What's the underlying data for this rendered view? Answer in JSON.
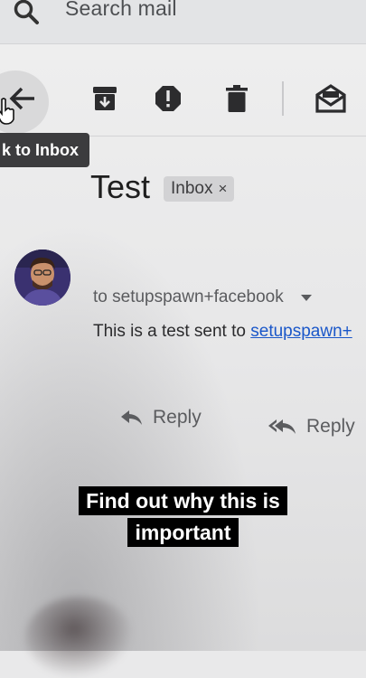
{
  "search": {
    "placeholder": "Search mail"
  },
  "toolbar": {
    "back_tooltip": "k to Inbox",
    "icons": [
      "back-arrow-icon",
      "archive-icon",
      "report-spam-icon",
      "delete-icon",
      "mark-unread-icon"
    ]
  },
  "message": {
    "subject": "Test",
    "label_chip": "Inbox",
    "label_chip_close": "×",
    "to_line": "to setupspawn+facebook",
    "body_prefix": "This is a test sent to ",
    "body_link": "setupspawn+"
  },
  "actions": {
    "reply": "Reply",
    "reply_all": "Reply"
  },
  "caption": {
    "line1": "Find out why this is",
    "line2": "important"
  },
  "colors": {
    "link": "#1a57c9",
    "tooltip_bg": "#3c3c3e",
    "caption_bg": "#000000"
  }
}
